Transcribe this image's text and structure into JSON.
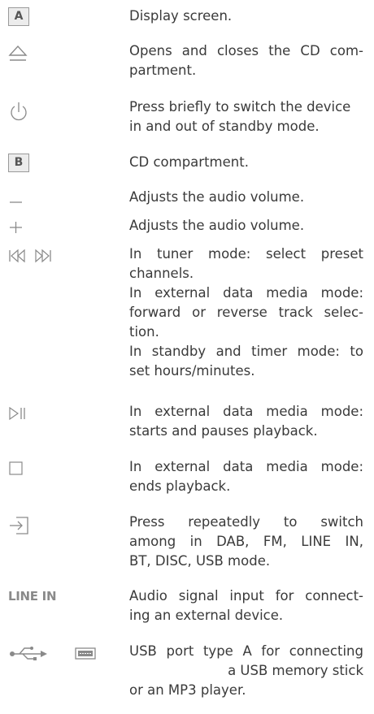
{
  "entries": [
    {
      "symbol": "A",
      "lines": [
        "Display screen."
      ]
    },
    {
      "icon": "eject-icon",
      "lines": [
        "Opens and closes the CD com-",
        "partment."
      ]
    },
    {
      "icon": "power-standby-icon",
      "lines": [
        "Press briefly to switch the device",
        "in and out of standby mode."
      ]
    },
    {
      "symbol": "B",
      "lines": [
        "CD compartment."
      ]
    },
    {
      "icon": "minus-icon",
      "lines": [
        "Adjusts the audio volume."
      ]
    },
    {
      "icon": "plus-icon",
      "lines": [
        "Adjusts the audio volume."
      ]
    },
    {
      "icon": "skip-prev-next-icon",
      "lines": [
        "In tuner mode: select preset",
        "channels.",
        "In external data media mode:",
        "forward or reverse track selec-",
        "tion.",
        "In standby and timer mode: to",
        "set hours/minutes."
      ]
    },
    {
      "icon": "play-pause-icon",
      "lines": [
        "In external data media mode:",
        "starts and pauses playback."
      ]
    },
    {
      "icon": "stop-icon",
      "lines": [
        "In external data media mode:",
        "ends playback."
      ]
    },
    {
      "icon": "source-input-icon",
      "lines": [
        "Press repeatedly to switch",
        "among in DAB, FM, LINE IN,",
        "BT, DISC, USB mode."
      ]
    },
    {
      "symbol": "LINE IN",
      "lines": [
        "Audio signal input for connect-",
        "ing an external device."
      ]
    },
    {
      "icon": "usb-port-icon",
      "lines": [
        "USB port type A for connecting",
        "a USB memory stick",
        "or an MP3 player."
      ]
    }
  ]
}
